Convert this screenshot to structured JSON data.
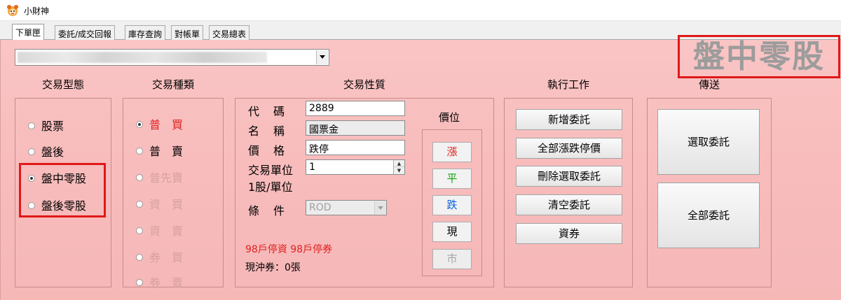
{
  "window": {
    "title": "小財神",
    "icon": "mascot-icon"
  },
  "tabs": [
    {
      "label": "下單匣",
      "active": true
    },
    {
      "label": "委託/成交回報",
      "active": false
    },
    {
      "label": "庫存查詢",
      "active": false
    },
    {
      "label": "對帳單",
      "active": false
    },
    {
      "label": "交易總表",
      "active": false
    }
  ],
  "account": {
    "value": ""
  },
  "mode_title": "盤中零股",
  "trade_type": {
    "title": "交易型態",
    "options": [
      {
        "label": "股票",
        "selected": false
      },
      {
        "label": "盤後",
        "selected": false
      },
      {
        "label": "盤中零股",
        "selected": true
      },
      {
        "label": "盤後零股",
        "selected": false
      }
    ]
  },
  "trade_kind": {
    "title": "交易種類",
    "options": [
      {
        "label": "普　買",
        "selected": true,
        "enabled": true
      },
      {
        "label": "普　賣",
        "selected": false,
        "enabled": true
      },
      {
        "label": "普先賣",
        "selected": false,
        "enabled": false
      },
      {
        "label": "資　買",
        "selected": false,
        "enabled": false
      },
      {
        "label": "資　賣",
        "selected": false,
        "enabled": false
      },
      {
        "label": "券　買",
        "selected": false,
        "enabled": false
      },
      {
        "label": "券　賣",
        "selected": false,
        "enabled": false
      }
    ]
  },
  "trade_nature": {
    "title": "交易性質",
    "code_label": "代　碼",
    "code_value": "2889",
    "name_label": "名　稱",
    "name_value": "國票金",
    "price_label": "價　格",
    "price_value": "跌停",
    "unit_label": "交易單位",
    "unit_value": "1",
    "unit_note": "1股/單位",
    "condition_label": "條　件",
    "condition_value": "ROD",
    "warning": "98戶停資  98戶停券",
    "day_trade": "現沖券：0張"
  },
  "price_pos": {
    "title": "價位",
    "buttons": [
      {
        "label": "漲",
        "color": "#e02020",
        "enabled": true
      },
      {
        "label": "平",
        "color": "#10a010",
        "enabled": true
      },
      {
        "label": "跌",
        "color": "#1060e0",
        "enabled": true
      },
      {
        "label": "現",
        "color": "#000000",
        "enabled": true
      },
      {
        "label": "市",
        "color": "#a5a5a5",
        "enabled": false
      }
    ]
  },
  "actions": {
    "title": "執行工作",
    "buttons": [
      "新增委託",
      "全部漲跌停價",
      "刪除選取委託",
      "清空委託",
      "資券"
    ]
  },
  "send": {
    "title": "傳送",
    "buttons": [
      "選取委託",
      "全部委託"
    ]
  }
}
